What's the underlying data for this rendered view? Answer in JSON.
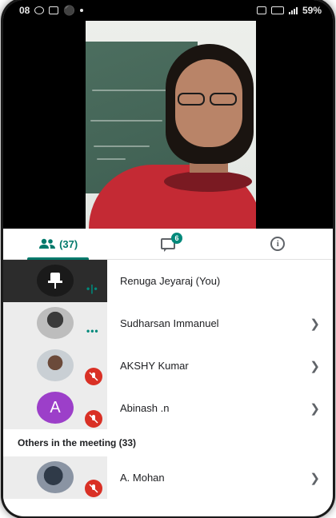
{
  "status_bar": {
    "time": "08",
    "battery": "59%",
    "icons_left": [
      "whatsapp-icon",
      "gallery-icon",
      "person-icon",
      "dot-icon"
    ],
    "icons_right": [
      "alarm-icon",
      "vowifi-icon",
      "signal-icon"
    ]
  },
  "video": {
    "tile_owner": "Renuga Jeyaraj (You)"
  },
  "tabs": {
    "people_count": "(37)",
    "chat_badge": "6",
    "info_label": "i"
  },
  "participants": [
    {
      "name": "Renuga Jeyaraj (You)",
      "state": "speaking",
      "avatar": "pin-placeholder"
    },
    {
      "name": "Sudharsan Immanuel",
      "state": "speaking",
      "avatar": "photo"
    },
    {
      "name": "AKSHY Kumar",
      "state": "muted",
      "avatar": "photo"
    },
    {
      "name": "Abinash .n",
      "state": "muted",
      "avatar": "A",
      "avatar_color": "#9c3fc9"
    }
  ],
  "section": {
    "others_label": "Others in the meeting (33)"
  },
  "others": [
    {
      "name": "A. Mohan",
      "state": "muted",
      "avatar": "photo"
    }
  ],
  "colors": {
    "accent": "#00796b",
    "mute_red": "#d93025",
    "status_bar_bg": "#000000"
  }
}
